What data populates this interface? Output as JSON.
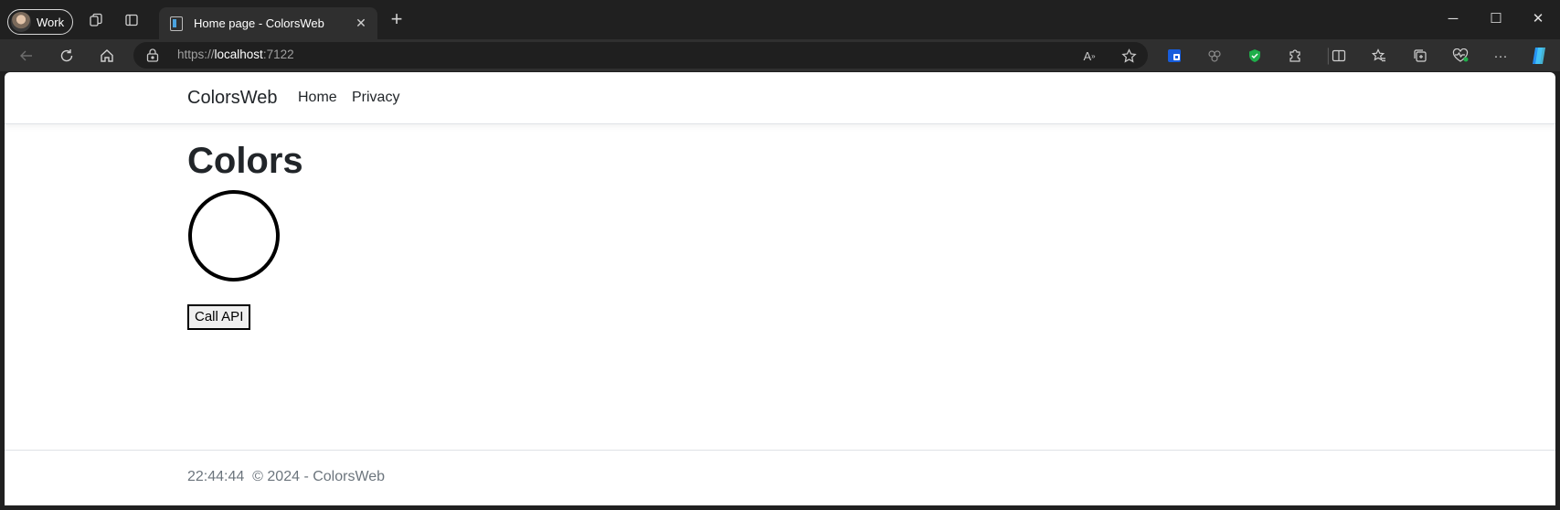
{
  "browser": {
    "profile_label": "Work",
    "tab_title": "Home page - ColorsWeb",
    "url_scheme": "https://",
    "url_host": "localhost",
    "url_port": ":7122"
  },
  "site": {
    "brand": "ColorsWeb",
    "nav": [
      "Home",
      "Privacy"
    ],
    "heading": "Colors",
    "button_label": "Call API",
    "footer_time": "22:44:44",
    "footer_copyright": "© 2024 - ColorsWeb",
    "circle_fill": "#ffffff"
  },
  "icons": [
    "workspaces-icon",
    "vertical-tabs-icon",
    "back-icon",
    "refresh-icon",
    "home-icon",
    "lock-icon",
    "read-aloud-icon",
    "favorite-star-icon",
    "bitwarden-icon",
    "extension-icon",
    "shield-icon",
    "extensions-puzzle-icon",
    "split-screen-icon",
    "favorites-icon",
    "collections-icon",
    "performance-icon",
    "more-icon",
    "copilot-icon"
  ]
}
